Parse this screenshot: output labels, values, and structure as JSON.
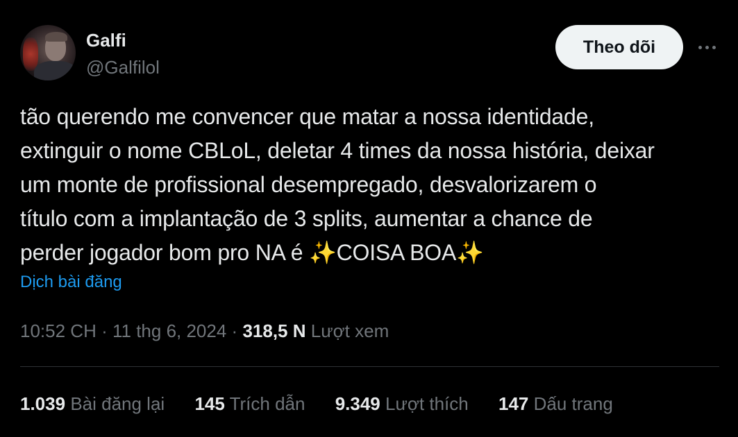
{
  "author": {
    "display_name": "Galfi",
    "handle": "@Galfilol",
    "avatar_icon": "profile-photo"
  },
  "actions": {
    "follow_label": "Theo dõi",
    "more_icon": "more-horizontal-icon"
  },
  "tweet": {
    "text": "tão querendo me convencer que matar a nossa identidade,\nextinguir o nome CBLoL, deletar 4 times da nossa história, deixar\num monte de profissional desempregado, desvalorizarem o\ntítulo com a implantação de 3 splits, aumentar a chance de\nperder jogador bom pro NA é ✨COISA BOA✨",
    "translate_label": "Dịch bài đăng"
  },
  "meta": {
    "time": "10:52 CH",
    "separator": "·",
    "date": "11 thg 6, 2024",
    "views_count": "318,5 N",
    "views_label": "Lượt xem"
  },
  "stats": [
    {
      "count": "1.039",
      "label": "Bài đăng lại"
    },
    {
      "count": "145",
      "label": "Trích dẫn"
    },
    {
      "count": "9.349",
      "label": "Lượt thích"
    },
    {
      "count": "147",
      "label": "Dấu trang"
    }
  ],
  "colors": {
    "background": "#000000",
    "primary_text": "#e7e9ea",
    "secondary_text": "#71767b",
    "link": "#1d9bf0",
    "follow_button_bg": "#eff3f4",
    "divider": "#2f3336"
  }
}
